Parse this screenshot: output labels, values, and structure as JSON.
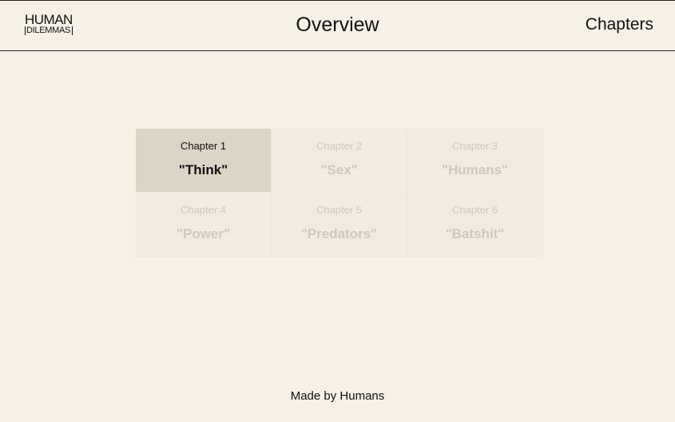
{
  "header": {
    "logo_top": "HUMAN",
    "logo_bottom": "DILEMMAS",
    "title": "Overview",
    "nav_label": "Chapters"
  },
  "chapters": [
    {
      "number": "Chapter 1",
      "name": "\"Think\"",
      "active": true
    },
    {
      "number": "Chapter 2",
      "name": "\"Sex\"",
      "active": false
    },
    {
      "number": "Chapter 3",
      "name": "\"Humans\"",
      "active": false
    },
    {
      "number": "Chapter 4",
      "name": "\"Power\"",
      "active": false
    },
    {
      "number": "Chapter 5",
      "name": "\"Predators\"",
      "active": false
    },
    {
      "number": "Chapter 6",
      "name": "\"Batshit\"",
      "active": false
    }
  ],
  "footer": {
    "text": "Made by Humans"
  }
}
